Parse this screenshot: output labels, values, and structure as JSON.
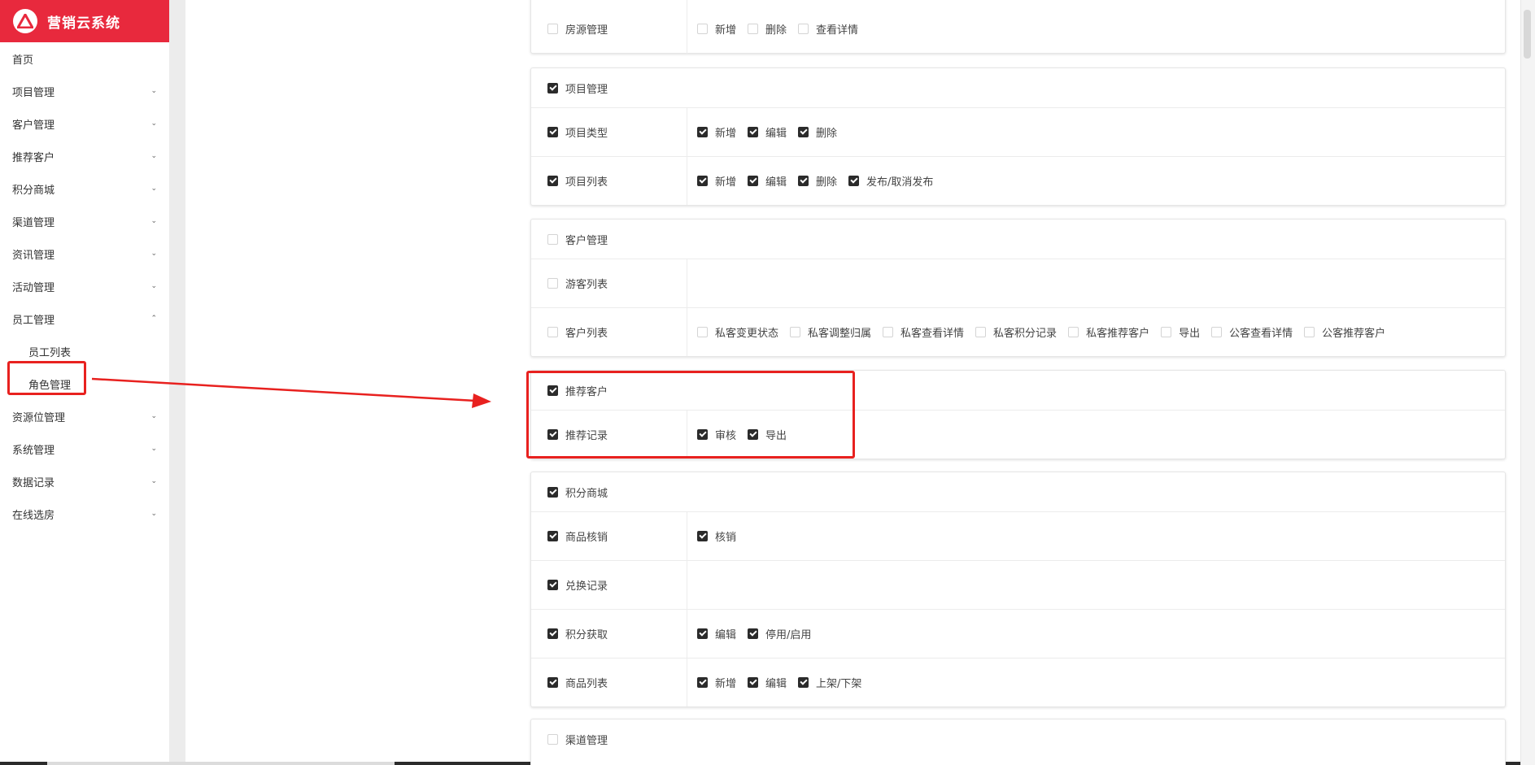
{
  "brand": {
    "title": "营销云系统",
    "logo_icon": "triangle-logo-icon"
  },
  "sidebar": {
    "items": [
      {
        "label": "首页",
        "chevron": ""
      },
      {
        "label": "项目管理",
        "chevron": "⌄"
      },
      {
        "label": "客户管理",
        "chevron": "⌄"
      },
      {
        "label": "推荐客户",
        "chevron": "⌄"
      },
      {
        "label": "积分商城",
        "chevron": "⌄"
      },
      {
        "label": "渠道管理",
        "chevron": "⌄"
      },
      {
        "label": "资讯管理",
        "chevron": "⌄"
      },
      {
        "label": "活动管理",
        "chevron": "⌄"
      },
      {
        "label": "员工管理",
        "chevron": "⌃"
      }
    ],
    "sub_items": [
      {
        "label": "员工列表"
      },
      {
        "label": "角色管理"
      }
    ],
    "items_after": [
      {
        "label": "资源位管理",
        "chevron": "⌄"
      },
      {
        "label": "系统管理",
        "chevron": "⌄"
      },
      {
        "label": "数据记录",
        "chevron": "⌄"
      },
      {
        "label": "在线选房",
        "chevron": "⌄"
      }
    ]
  },
  "cards": {
    "c0": {
      "rows": [
        {
          "label": "房源管理",
          "checked": false,
          "opts": [
            {
              "label": "新增",
              "checked": false
            },
            {
              "label": "删除",
              "checked": false
            },
            {
              "label": "查看详情",
              "checked": false
            }
          ]
        }
      ]
    },
    "c1": {
      "title": "项目管理",
      "checked": true,
      "rows": [
        {
          "label": "项目类型",
          "checked": true,
          "opts": [
            {
              "label": "新增",
              "checked": true
            },
            {
              "label": "编辑",
              "checked": true
            },
            {
              "label": "删除",
              "checked": true
            }
          ]
        },
        {
          "label": "项目列表",
          "checked": true,
          "opts": [
            {
              "label": "新增",
              "checked": true
            },
            {
              "label": "编辑",
              "checked": true
            },
            {
              "label": "删除",
              "checked": true
            },
            {
              "label": "发布/取消发布",
              "checked": true
            }
          ]
        }
      ]
    },
    "c2": {
      "title": "客户管理",
      "checked": false,
      "rows": [
        {
          "label": "游客列表",
          "checked": false,
          "opts": []
        },
        {
          "label": "客户列表",
          "checked": false,
          "opts": [
            {
              "label": "私客变更状态",
              "checked": false
            },
            {
              "label": "私客调整归属",
              "checked": false
            },
            {
              "label": "私客查看详情",
              "checked": false
            },
            {
              "label": "私客积分记录",
              "checked": false
            },
            {
              "label": "私客推荐客户",
              "checked": false
            },
            {
              "label": "导出",
              "checked": false
            },
            {
              "label": "公客查看详情",
              "checked": false
            },
            {
              "label": "公客推荐客户",
              "checked": false
            }
          ]
        }
      ]
    },
    "c3": {
      "title": "推荐客户",
      "checked": true,
      "rows": [
        {
          "label": "推荐记录",
          "checked": true,
          "opts": [
            {
              "label": "审核",
              "checked": true
            },
            {
              "label": "导出",
              "checked": true
            }
          ]
        }
      ]
    },
    "c4": {
      "title": "积分商城",
      "checked": true,
      "rows": [
        {
          "label": "商品核销",
          "checked": true,
          "opts": [
            {
              "label": "核销",
              "checked": true
            }
          ]
        },
        {
          "label": "兑换记录",
          "checked": true,
          "opts": []
        },
        {
          "label": "积分获取",
          "checked": true,
          "opts": [
            {
              "label": "编辑",
              "checked": true
            },
            {
              "label": "停用/启用",
              "checked": true
            }
          ]
        },
        {
          "label": "商品列表",
          "checked": true,
          "opts": [
            {
              "label": "新增",
              "checked": true
            },
            {
              "label": "编辑",
              "checked": true
            },
            {
              "label": "上架/下架",
              "checked": true
            }
          ]
        }
      ]
    },
    "c5": {
      "title": "渠道管理",
      "checked": false
    }
  },
  "colors": {
    "brand_red": "#e8293d",
    "highlight_red": "#e8211f",
    "checkbox_checked": "#2b2b2b"
  }
}
